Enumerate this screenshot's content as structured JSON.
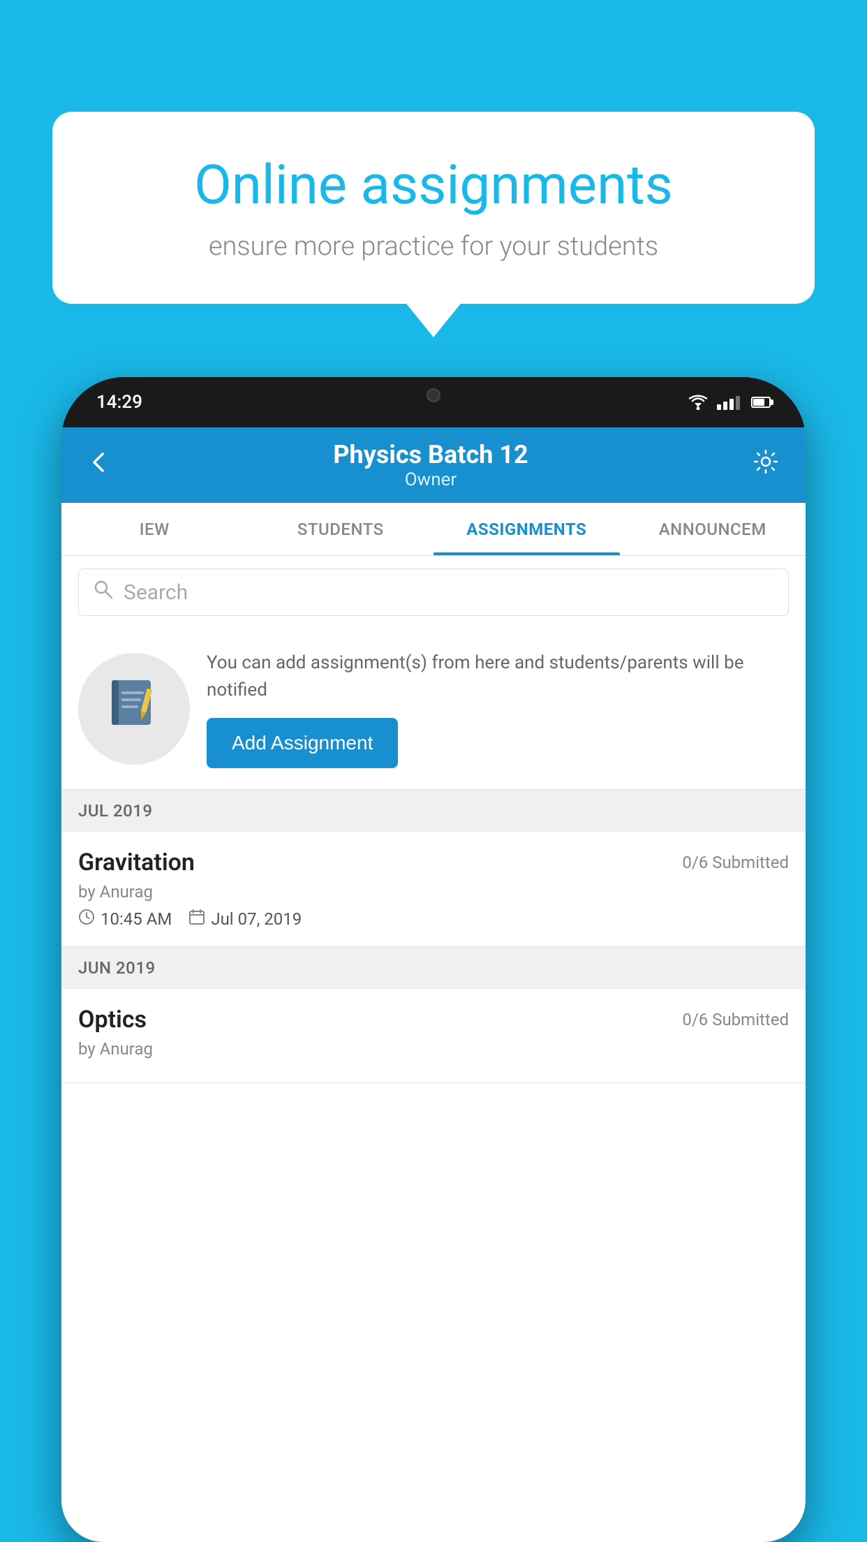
{
  "background_color": "#1ab8e8",
  "promo": {
    "title": "Online assignments",
    "subtitle": "ensure more practice for your students"
  },
  "status_bar": {
    "time": "14:29"
  },
  "app_header": {
    "title": "Physics Batch 12",
    "subtitle": "Owner"
  },
  "tabs": [
    {
      "id": "view",
      "label": "IEW"
    },
    {
      "id": "students",
      "label": "STUDENTS"
    },
    {
      "id": "assignments",
      "label": "ASSIGNMENTS",
      "active": true
    },
    {
      "id": "announcements",
      "label": "ANNOUNCEM"
    }
  ],
  "search": {
    "placeholder": "Search"
  },
  "promo_section": {
    "description": "You can add assignment(s) from here and students/parents will be notified",
    "button_label": "Add Assignment"
  },
  "sections": [
    {
      "month_label": "JUL 2019",
      "assignments": [
        {
          "title": "Gravitation",
          "submitted": "0/6 Submitted",
          "by": "by Anurag",
          "time": "10:45 AM",
          "date": "Jul 07, 2019"
        }
      ]
    },
    {
      "month_label": "JUN 2019",
      "assignments": [
        {
          "title": "Optics",
          "submitted": "0/6 Submitted",
          "by": "by Anurag",
          "time": "",
          "date": ""
        }
      ]
    }
  ]
}
